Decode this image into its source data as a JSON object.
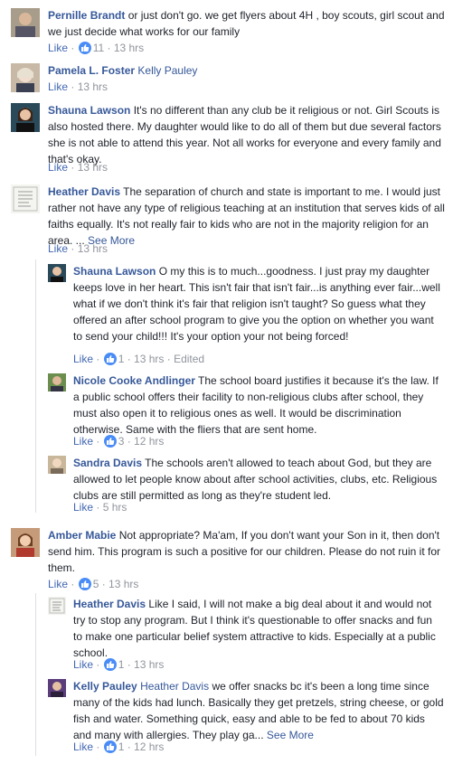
{
  "comments": [
    {
      "name": "Pernille Brandt",
      "text": "or just don't go. we get flyers about 4H , boy scouts, girl scout and we just decide what works for our family",
      "like": "Like",
      "reaction_count": "11",
      "time": "13 hrs"
    },
    {
      "name": "Pamela L. Foster",
      "mention": "Kelly Pauley",
      "like": "Like",
      "time": "13 hrs"
    },
    {
      "name": "Shauna Lawson",
      "text": "It's no different than any club be it religious or not. Girl Scouts is also hosted there. My daughter would like to do all of them but due several factors she is not able to attend this year. Not all works for everyone and every family and that's okay.",
      "like": "Like",
      "time": "13 hrs"
    },
    {
      "name": "Heather Davis",
      "text": "The separation of church and state is important to me. I would just rather not have any type of religious teaching at an institution that serves kids of all faiths equally. It's not really fair to kids who are not in the majority religion for an area. ...",
      "see_more": "See More",
      "like": "Like",
      "time": "13 hrs"
    },
    {
      "name": "Shauna Lawson",
      "text": "O my this is to much...goodness. I just pray my daughter keeps love in her heart. This isn't fair that isn't fair...is anything ever fair...well what if we don't think it's fair that religion isn't taught? So guess what they offered an after school program to give you the option on whether you want to send your child!!! It's your option your not being forced!",
      "like": "Like",
      "reaction_count": "1",
      "time": "13 hrs",
      "edited": "Edited"
    },
    {
      "name": "Nicole Cooke Andlinger",
      "text": "The school board justifies it because it's the law. If a public school offers their facility to non-religious clubs after school, they must also open it to religious ones as well. It would be discrimination otherwise. Same with the fliers that are sent home.",
      "like": "Like",
      "reaction_count": "3",
      "time": "12 hrs"
    },
    {
      "name": "Sandra Davis",
      "text": "The schools aren't allowed to teach about God, but they are allowed to let people know about after school activities, clubs, etc. Religious clubs are still permitted as long as they're student led.",
      "like": "Like",
      "time": "5 hrs"
    },
    {
      "name": "Amber Mabie",
      "text": "Not appropriate? Ma'am, If you don't want your Son in it, then don't send him. This program is such a positive for our children. Please do not ruin it for them.",
      "like": "Like",
      "reaction_count": "5",
      "time": "13 hrs"
    },
    {
      "name": "Heather Davis",
      "text": "Like I said, I will not make a big deal about it and would not try to stop any program. But I think it's questionable to offer snacks and fun to make one particular belief system attractive to kids. Especially at a public school.",
      "like": "Like",
      "reaction_count": "1",
      "time": "13 hrs"
    },
    {
      "name": "Kelly Pauley",
      "mention": "Heather Davis",
      "text": "we offer snacks bc it's been a long time since many of the kids had lunch. Basically they get pretzels, string cheese, or gold fish and water. Something quick, easy and able to be fed to about 70 kids and many with allergies. They play ga...",
      "see_more": "See More",
      "like": "Like",
      "reaction_count": "1",
      "time": "12 hrs"
    }
  ],
  "separator": " · ",
  "icons": {
    "reaction": "thumbs-up-icon"
  },
  "colors": {
    "name": "#365899",
    "meta": "#90949c",
    "reaction": "#4a8cf7"
  }
}
